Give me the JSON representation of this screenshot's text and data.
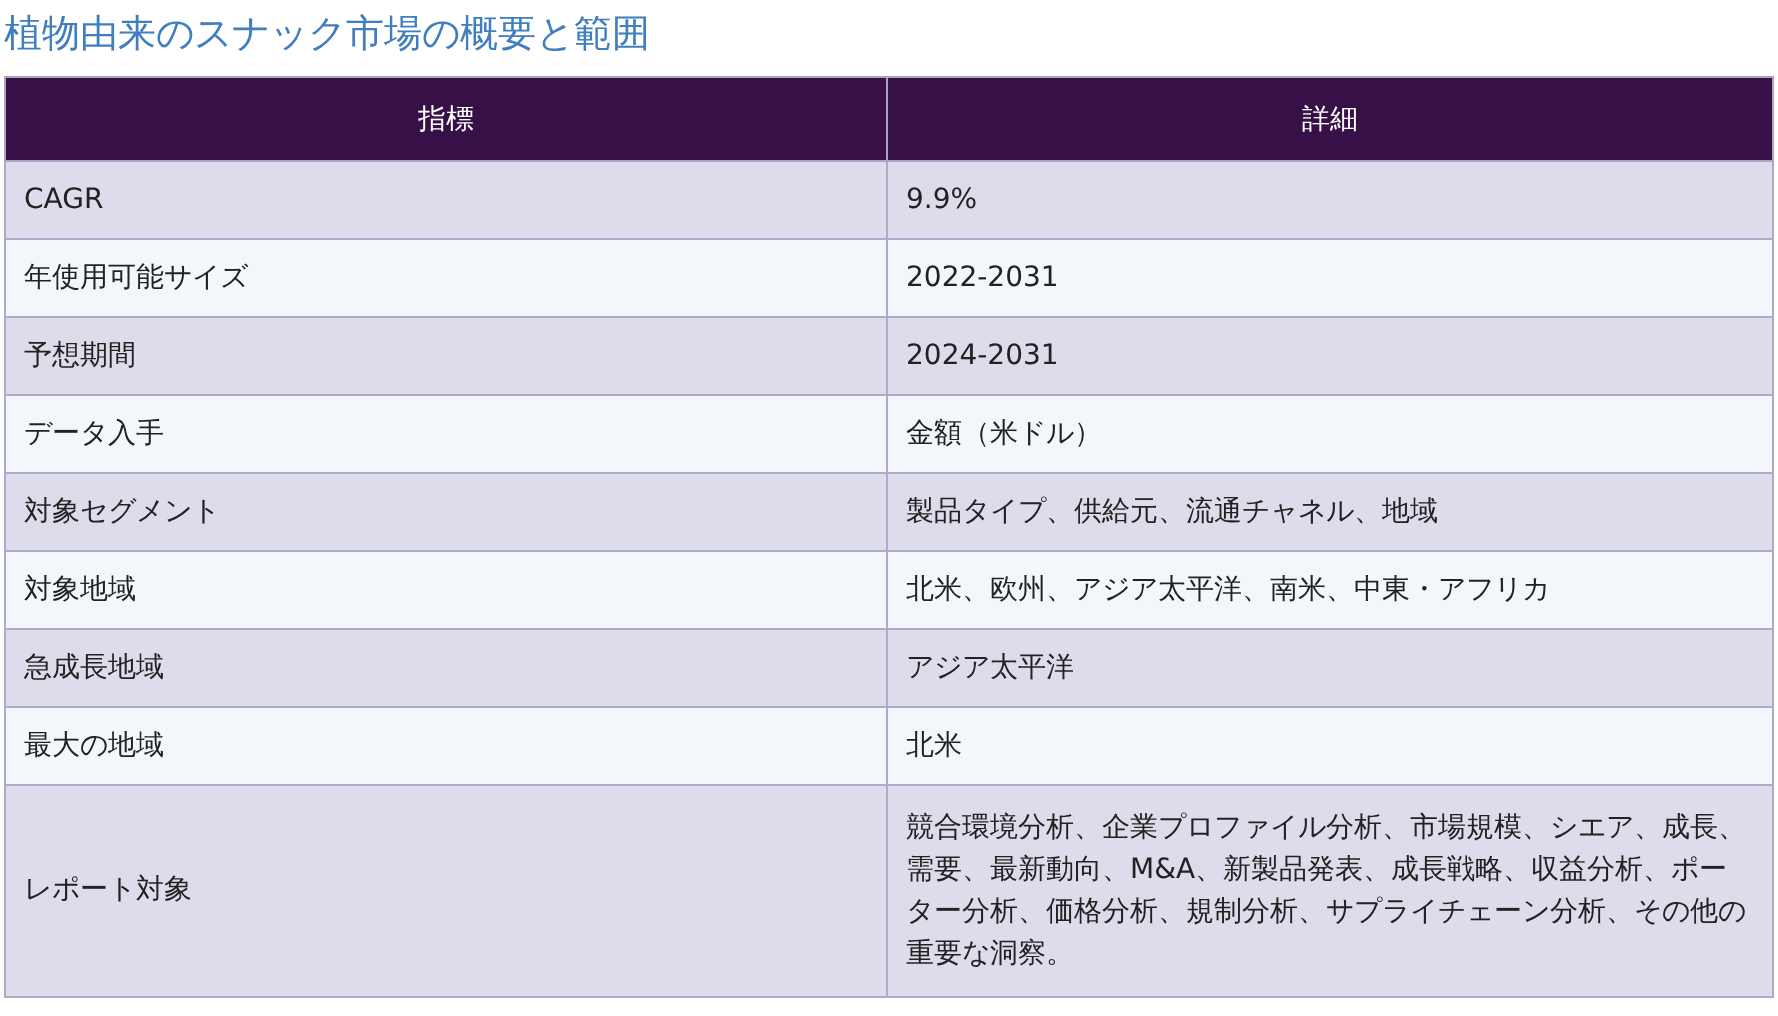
{
  "title": "植物由来のスナック市場の概要と範囲",
  "table": {
    "columns": [
      "指標",
      "詳細"
    ],
    "rows": [
      {
        "cells": [
          "CAGR",
          "9.9%"
        ]
      },
      {
        "cells": [
          "年使用可能サイズ",
          "2022-2031"
        ]
      },
      {
        "cells": [
          "予想期間",
          "2024-2031"
        ]
      },
      {
        "cells": [
          "データ入手",
          "金額（米ドル）"
        ]
      },
      {
        "cells": [
          "対象セグメント",
          "製品タイプ、供給元、流通チャネル、地域"
        ]
      },
      {
        "cells": [
          "対象地域",
          "北米、欧州、アジア太平洋、南米、中東・アフリカ"
        ]
      },
      {
        "cells": [
          "急成長地域",
          "アジア太平洋"
        ]
      },
      {
        "cells": [
          "最大の地域",
          "北米"
        ]
      },
      {
        "cells": [
          "レポート対象",
          "競合環境分析、企業プロファイル分析、市場規模、シエア、成長、需要、最新動向、M&A、新製品発表、成長戦略、収益分析、ポーター分析、価格分析、規制分析、サプライチェーン分析、その他の重要な洞察。"
        ]
      }
    ]
  }
}
